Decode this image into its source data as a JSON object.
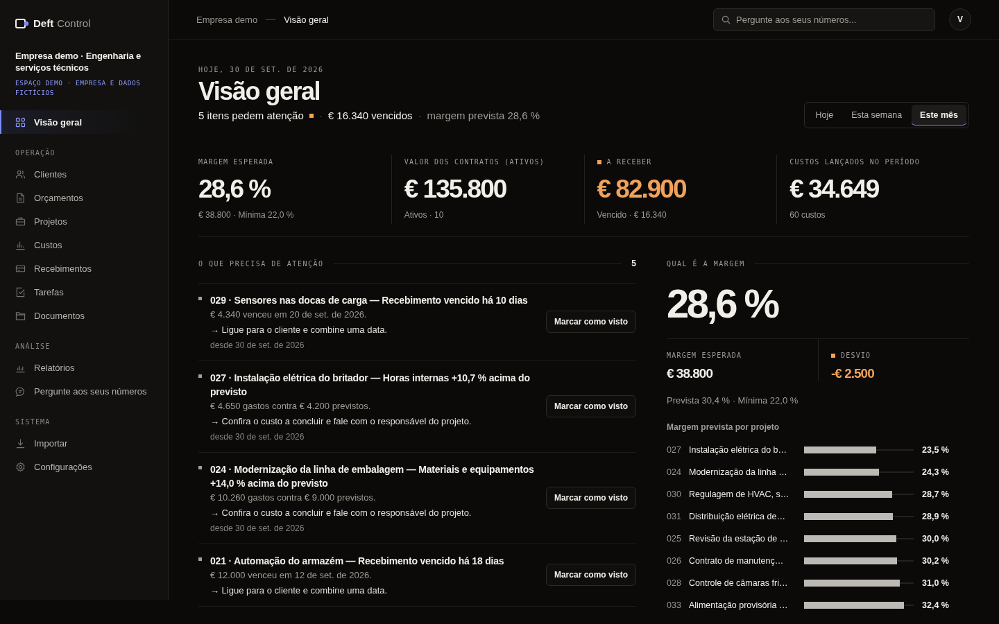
{
  "brand": {
    "name": "Deft",
    "product": "Control"
  },
  "workspace": {
    "name": "Empresa demo · Engenharia e serviços técnicos",
    "tag": "ESPAÇO DEMO · EMPRESA E DADOS FICTÍCIOS"
  },
  "sidebar": {
    "sections": [
      {
        "items": [
          {
            "label": "Visão geral",
            "selected": true
          }
        ]
      },
      {
        "title": "OPERAÇÃO",
        "items": [
          {
            "label": "Clientes",
            "selected": false
          },
          {
            "label": "Orçamentos",
            "selected": false
          },
          {
            "label": "Projetos",
            "selected": false
          },
          {
            "label": "Custos",
            "selected": false
          },
          {
            "label": "Recebimentos",
            "selected": false
          },
          {
            "label": "Tarefas",
            "selected": false
          },
          {
            "label": "Documentos",
            "selected": false
          }
        ]
      },
      {
        "title": "ANÁLISE",
        "items": [
          {
            "label": "Relatórios",
            "selected": false
          },
          {
            "label": "Pergunte aos seus números",
            "selected": false
          }
        ]
      },
      {
        "title": "SISTEMA",
        "items": [
          {
            "label": "Importar",
            "selected": false
          },
          {
            "label": "Configurações",
            "selected": false
          }
        ]
      }
    ]
  },
  "breadcrumb": [
    "Empresa demo",
    "Visão geral"
  ],
  "search": {
    "placeholder": "Pergunte aos seus números..."
  },
  "avatar": "V",
  "header": {
    "date": "HOJE, 30 DE SET. DE 2026",
    "title": "Visão geral",
    "summary_separator": "·",
    "summary": [
      {
        "text": "5 itens pedem atenção",
        "flag": true,
        "kind": "strong"
      },
      {
        "text": "€ 16.340 vencidos",
        "kind": "strong"
      },
      {
        "text": "margem prevista 28,6 %",
        "kind": "muted"
      }
    ]
  },
  "periods": [
    {
      "label": "Hoje",
      "selected": false
    },
    {
      "label": "Esta semana",
      "selected": false
    },
    {
      "label": "Este mês",
      "selected": true
    }
  ],
  "kpis": [
    {
      "label": "MARGEM ESPERADA",
      "value": "28,6 %",
      "sub": "€ 38.800 · Mínima 22,0 %"
    },
    {
      "label": "VALOR DOS CONTRATOS (ATIVOS)",
      "value": "€ 135.800",
      "sub": "Ativos · 10"
    },
    {
      "label": "A RECEBER",
      "value": "€ 82.900",
      "sub": "Vencido · € 16.340",
      "flag": true
    },
    {
      "label": "CUSTOS LANÇADOS NO PERÍODO",
      "value": "€ 34.649",
      "sub": "60 custos"
    }
  ],
  "attention": {
    "title": "O QUE PRECISA DE ATENÇÃO",
    "count": "5",
    "items": [
      {
        "title": "029 · Sensores nas docas de carga — Recebimento vencido há 10 dias",
        "detail": "€ 4.340 venceu em 20 de set. de 2026.",
        "action": "→ Ligue para o cliente e combine uma data.",
        "since": "desde 30 de set. de 2026",
        "button": "Marcar como visto"
      },
      {
        "title": "027 · Instalação elétrica do britador — Horas internas +10,7 % acima do previsto",
        "detail": "€ 4.650 gastos contra € 4.200 previstos.",
        "action": "→ Confira o custo a concluir e fale com o responsável do projeto.",
        "since": "desde 30 de set. de 2026",
        "button": "Marcar como visto"
      },
      {
        "title": "024 · Modernização da linha de embalagem — Materiais e equipamentos +14,0 % acima do previsto",
        "detail": "€ 10.260 gastos contra € 9.000 previstos.",
        "action": "→ Confira o custo a concluir e fale com o responsável do projeto.",
        "since": "desde 30 de set. de 2026",
        "button": "Marcar como visto"
      },
      {
        "title": "021 · Automação do armazém — Recebimento vencido há 18 dias",
        "detail": "€ 12.000 venceu em 12 de set. de 2026.",
        "action": "→ Ligue para o cliente e combine uma data.",
        "button": "Marcar como visto"
      }
    ]
  },
  "margin": {
    "title": "QUAL É A MARGEM",
    "value": "28,6 %",
    "stats": [
      {
        "label": "MARGEM ESPERADA",
        "value": "€ 38.800"
      },
      {
        "label": "DESVIO",
        "value": "-€ 2.500",
        "flag": true
      }
    ],
    "note": "Prevista 30,4 % · Mínima 22,0 %",
    "project_codes": [
      "027",
      "024",
      "030",
      "031",
      "025",
      "026",
      "028",
      "033"
    ],
    "chart_data": {
      "type": "bar",
      "orientation": "horizontal",
      "title": "Margem prevista por projeto",
      "categories": [
        "Instalação elétrica do b…",
        "Modernização da linha …",
        "Regulagem de HVAC, s…",
        "Distribuição elétrica de…",
        "Revisão da estação de …",
        "Contrato de manutenç…",
        "Controle de câmaras fri…",
        "Alimentação provisória …"
      ],
      "values": [
        23.5,
        24.3,
        28.7,
        28.9,
        30.0,
        30.2,
        31.0,
        32.4
      ],
      "xlim": [
        0,
        35.6
      ],
      "value_labels": [
        "23,5 %",
        "24,3 %",
        "28,7 %",
        "28,9 %",
        "30,0 %",
        "30,2 %",
        "31,0 %",
        "32,4 %"
      ]
    }
  }
}
